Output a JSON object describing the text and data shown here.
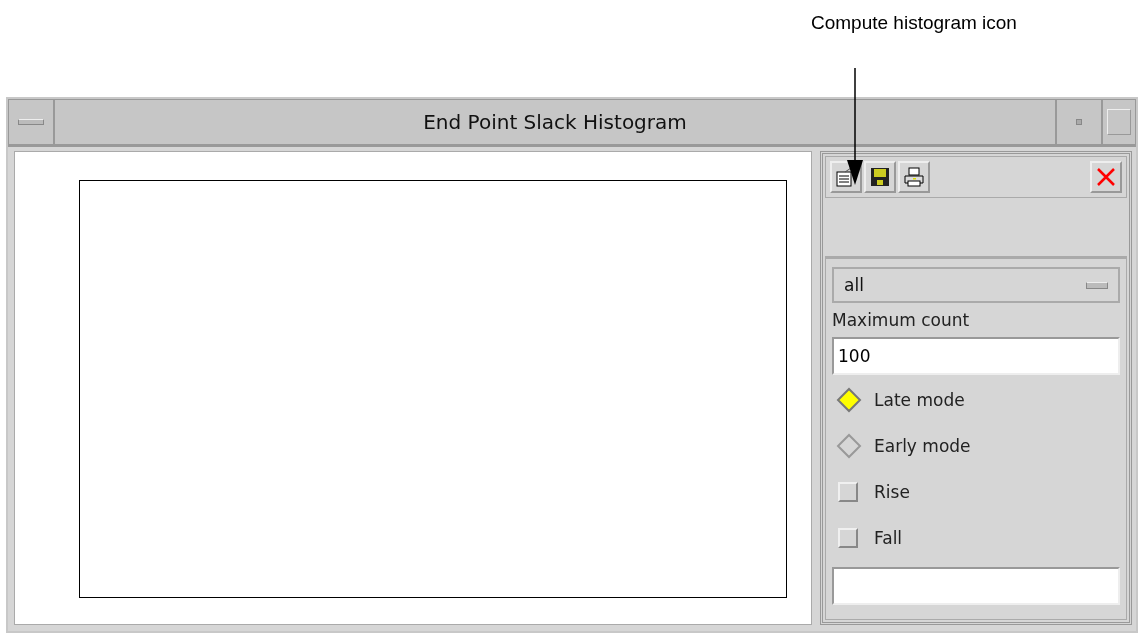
{
  "callout": {
    "label": "Compute histogram icon"
  },
  "window": {
    "title": "End Point Slack Histogram"
  },
  "panel": {
    "dropdown": {
      "value": "all"
    },
    "max_count": {
      "label": "Maximum count",
      "value": "100"
    },
    "modes": [
      {
        "label": "Late mode",
        "selected": true
      },
      {
        "label": "Early mode",
        "selected": false
      }
    ],
    "edges": [
      {
        "label": "Rise",
        "checked": false
      },
      {
        "label": "Fall",
        "checked": false
      }
    ]
  }
}
